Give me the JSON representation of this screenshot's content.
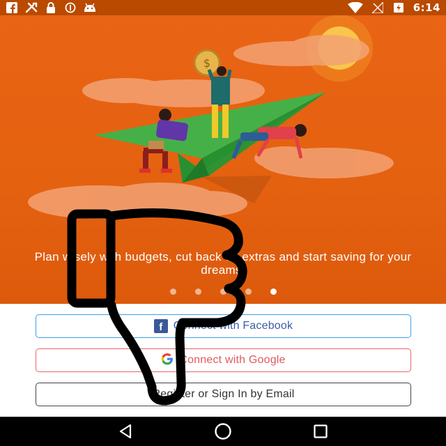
{
  "status_bar": {
    "time": "6:14",
    "left_icons": [
      "facebook-icon",
      "tools-icon",
      "lock-icon",
      "circle-info-icon",
      "android-icon"
    ],
    "right_icons": [
      "wifi-icon",
      "no-signal-icon",
      "battery-charging-icon"
    ]
  },
  "hero": {
    "tagline": "Plan wisely with budgets, cut back on extras and start saving for your dreams.",
    "page_count": 5,
    "active_page": 5
  },
  "auth": {
    "facebook_label": "Connect with Facebook",
    "google_label": "Connect with Google",
    "email_label": "Register or Sign In by Email"
  },
  "nav_bar": {
    "buttons": [
      "back-icon",
      "home-icon",
      "recents-icon"
    ]
  },
  "colors": {
    "hero_orange": "#e46110",
    "status_bar": "#b94a00",
    "facebook_blue": "#3b5998",
    "facebook_border": "#3aa0e4",
    "google_red": "#e15a5a"
  }
}
